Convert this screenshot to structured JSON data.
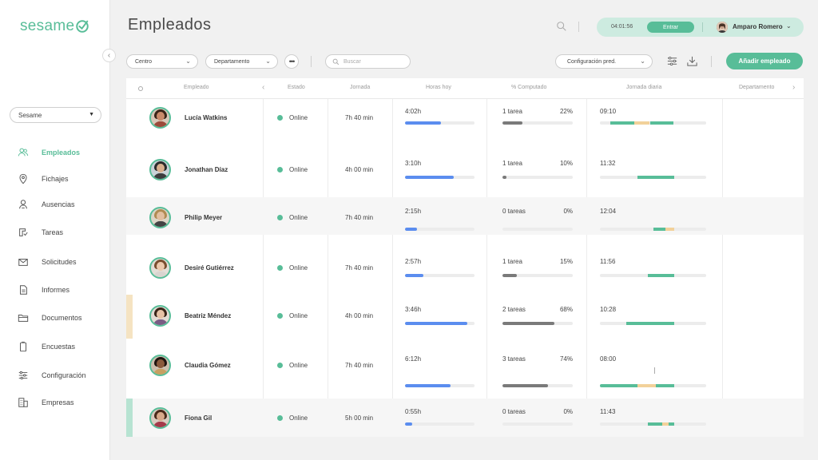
{
  "brand": {
    "name": "sesame",
    "accent": "#58bd98"
  },
  "sidebar": {
    "company": "Sesame",
    "items": [
      {
        "label": "Empleados",
        "icon": "users-icon",
        "active": true
      },
      {
        "label": "Fichajes",
        "icon": "location-pin-icon",
        "active": false
      },
      {
        "label": "Ausencias",
        "icon": "user-absent-icon",
        "active": false
      },
      {
        "label": "Tareas",
        "icon": "task-icon",
        "active": false
      },
      {
        "label": "Solicitudes",
        "icon": "envelope-icon",
        "active": false
      },
      {
        "label": "Informes",
        "icon": "document-icon",
        "active": false
      },
      {
        "label": "Documentos",
        "icon": "folder-icon",
        "active": false
      },
      {
        "label": "Encuestas",
        "icon": "clipboard-icon",
        "active": false
      },
      {
        "label": "Configuración",
        "icon": "sliders-icon",
        "active": false
      },
      {
        "label": "Empresas",
        "icon": "building-icon",
        "active": false
      }
    ]
  },
  "header": {
    "title": "Empleados",
    "clock_time": "04:01:56",
    "clock_action": "Entrar",
    "user_name": "Amparo Romero"
  },
  "filters": {
    "centro": "Centro",
    "departamento": "Departamento",
    "search_placeholder": "Buscar",
    "config": "Configuración pred.",
    "add_employee": "Añadir empleado"
  },
  "table": {
    "columns": [
      "Empleado",
      "Estado",
      "Jornada",
      "Horas hoy",
      "% Computado",
      "Jornada diaria",
      "Departamento"
    ],
    "rows": [
      {
        "name": "Lucía Watkins",
        "status": "Online",
        "jornada": "7h 40 min",
        "hours": "4:02h",
        "hours_progress": 0.52,
        "tasks": "1 tarea",
        "pct": "22%",
        "pct_progress": 0.28,
        "day_start": "09:10",
        "marker": ""
      },
      {
        "name": "Jonathan Díaz",
        "status": "Online",
        "jornada": "4h 00 min",
        "hours": "3:10h",
        "hours_progress": 0.7,
        "tasks": "1 tarea",
        "pct": "10%",
        "pct_progress": 0.06,
        "day_start": "11:32",
        "marker": ""
      },
      {
        "name": "Philip Meyer",
        "status": "Online",
        "jornada": "7h 40 min",
        "hours": "2:15h",
        "hours_progress": 0.17,
        "tasks": "0 tareas",
        "pct": "0%",
        "pct_progress": 0.0,
        "day_start": "12:04",
        "marker": ""
      },
      {
        "name": "Desiré Gutiérrez",
        "status": "Online",
        "jornada": "7h 40 min",
        "hours": "2:57h",
        "hours_progress": 0.27,
        "tasks": "1 tarea",
        "pct": "15%",
        "pct_progress": 0.21,
        "day_start": "11:56",
        "marker": ""
      },
      {
        "name": "Beatriz Méndez",
        "status": "Online",
        "jornada": "4h 00 min",
        "hours": "3:46h",
        "hours_progress": 0.9,
        "tasks": "2 tareas",
        "pct": "68%",
        "pct_progress": 0.74,
        "day_start": "10:28",
        "marker": "#f5e3c2"
      },
      {
        "name": "Claudia Gómez",
        "status": "Online",
        "jornada": "7h 40 min",
        "hours": "6:12h",
        "hours_progress": 0.66,
        "tasks": "3 tareas",
        "pct": "74%",
        "pct_progress": 0.65,
        "day_start": "08:00",
        "marker": ""
      },
      {
        "name": "Fiona Gil",
        "status": "Online",
        "jornada": "5h 00 min",
        "hours": "0:55h",
        "hours_progress": 0.1,
        "tasks": "0 tareas",
        "pct": "0%",
        "pct_progress": 0.0,
        "day_start": "11:43",
        "marker": "#b7e3d2"
      }
    ]
  },
  "colors": {
    "hours_bar": "#5b8def",
    "pct_bar": "#7a7a7a",
    "day_green": "#58bd98",
    "day_yellow": "#f2d19a"
  }
}
